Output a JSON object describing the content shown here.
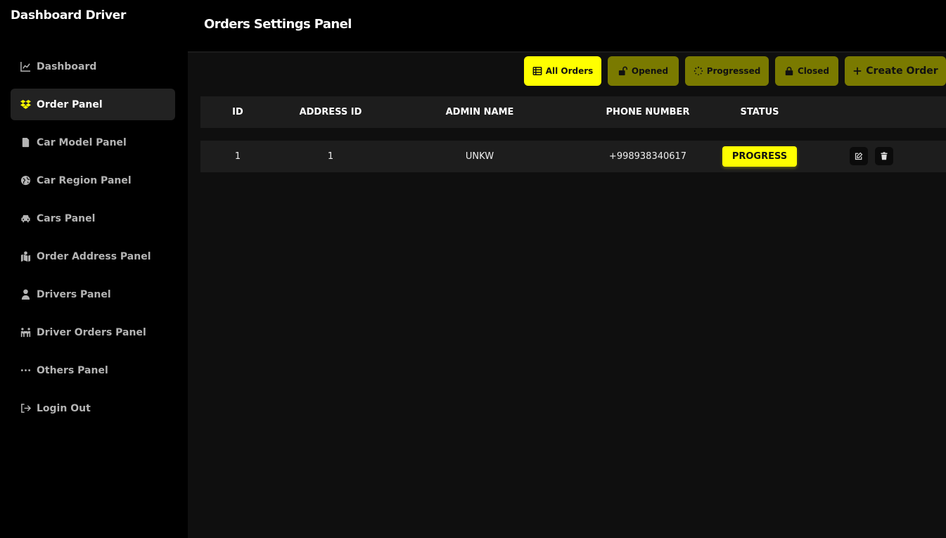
{
  "app": {
    "brand": "Dashboard Driver"
  },
  "sidebar": {
    "items": [
      {
        "label": "Dashboard",
        "icon": "chart-line-icon",
        "active": false
      },
      {
        "label": "Order Panel",
        "icon": "dropbox-icon",
        "active": true
      },
      {
        "label": "Car Model Panel",
        "icon": "sim-card-icon",
        "active": false
      },
      {
        "label": "Car Region Panel",
        "icon": "globe-icon",
        "active": false
      },
      {
        "label": "Cars Panel",
        "icon": "taxi-icon",
        "active": false
      },
      {
        "label": "Order Address Panel",
        "icon": "map-location-icon",
        "active": false
      },
      {
        "label": "Drivers Panel",
        "icon": "user-tie-icon",
        "active": false
      },
      {
        "label": "Driver Orders Panel",
        "icon": "people-carry-icon",
        "active": false
      },
      {
        "label": "Others Panel",
        "icon": "ellipsis-icon",
        "active": false
      },
      {
        "label": "Login Out",
        "icon": "sign-out-icon",
        "active": false
      }
    ]
  },
  "header": {
    "title": "Orders Settings Panel"
  },
  "toolbar": {
    "all_orders": "All Orders",
    "opened": "Opened",
    "progressed": "Progressed",
    "closed": "Closed",
    "create": "Create Order"
  },
  "table": {
    "columns": [
      "ID",
      "ADDRESS ID",
      "ADMIN NAME",
      "PHONE NUMBER",
      "STATUS"
    ],
    "rows": [
      {
        "id": "1",
        "address_id": "1",
        "admin_name": "UNKW",
        "phone": "+998938340617",
        "status": "PROGRESS"
      }
    ]
  },
  "colors": {
    "accent": "#ffff00",
    "accent_muted": "#7a7a00",
    "bg": "#000000",
    "panel": "#0f0f0f",
    "row": "#1d1d1d"
  }
}
